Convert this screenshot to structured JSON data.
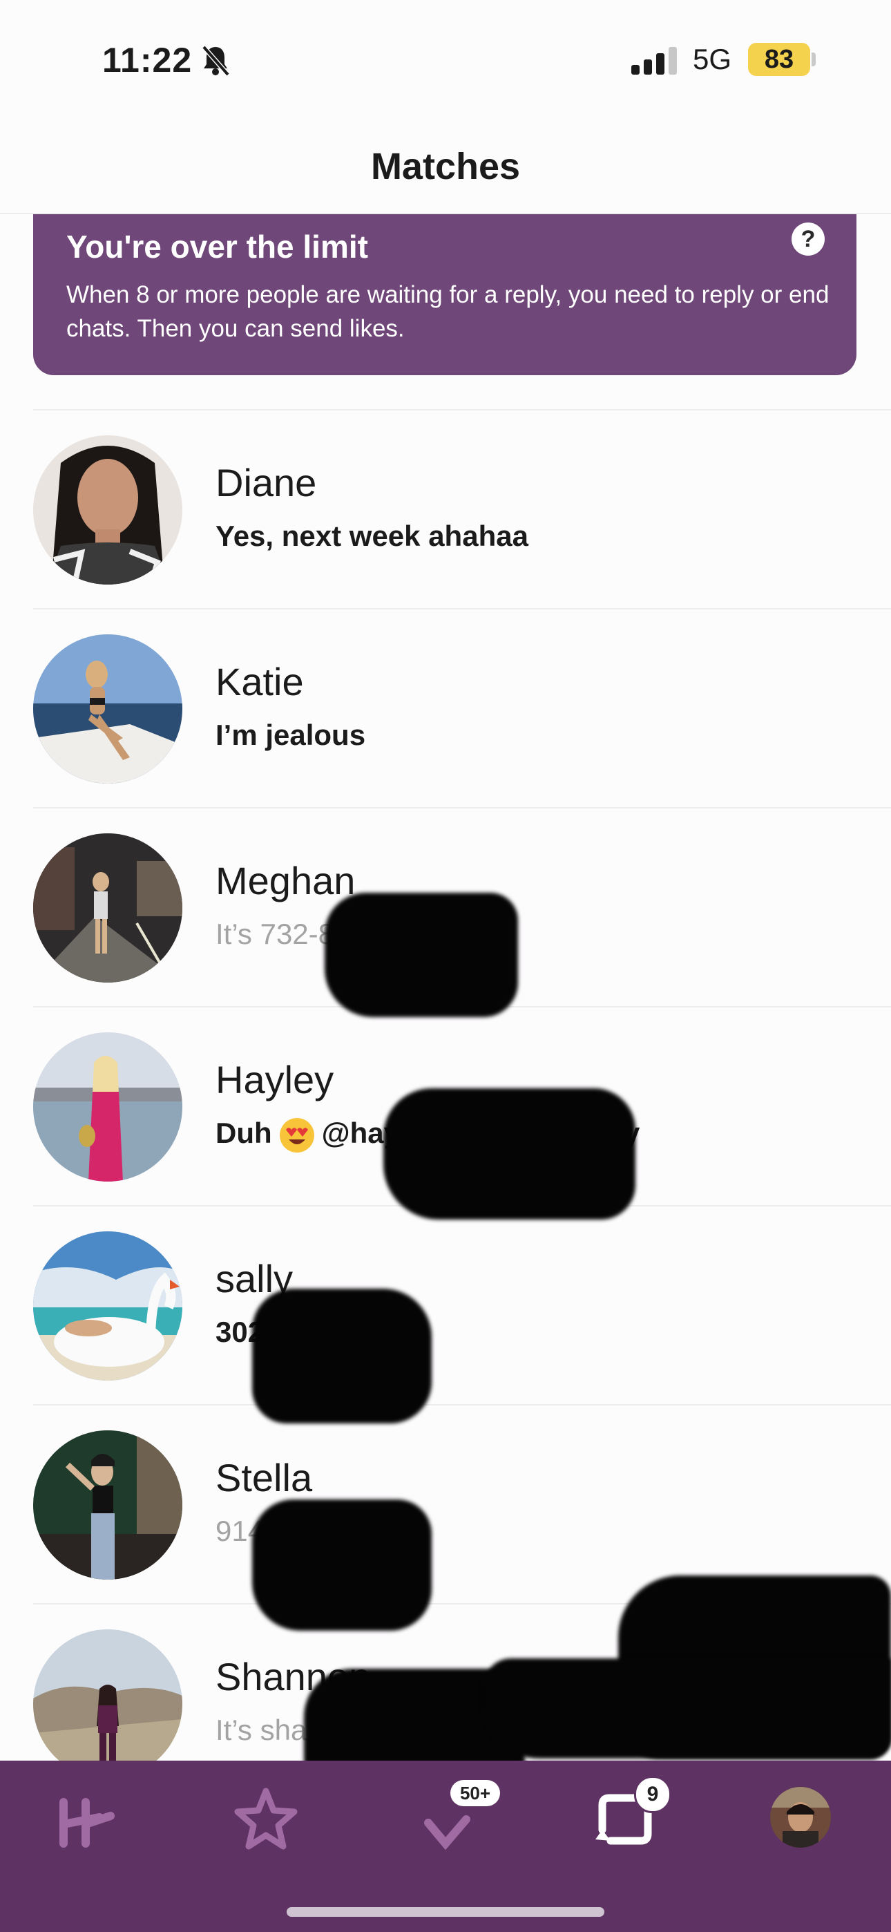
{
  "status_bar": {
    "time": "11:22",
    "network": "5G",
    "battery": "83"
  },
  "header": {
    "title": "Matches"
  },
  "banner": {
    "title": "You're over the limit",
    "help_label": "?",
    "text": "When 8 or more people are waiting for a reply, you need to reply or end chats. Then you can send likes."
  },
  "matches": [
    {
      "name": "Diane",
      "message": "Yes, next week ahahaa",
      "style": "bold"
    },
    {
      "name": "Katie",
      "message": "I’m jealous",
      "style": "bold"
    },
    {
      "name": "Meghan",
      "message": "It’s 732-8",
      "style": "light"
    },
    {
      "name": "Hayley",
      "message_pre": "Duh",
      "message_post": "@hay",
      "message_tail": "y",
      "style": "bold"
    },
    {
      "name": "sally",
      "message": "302",
      "style": "bold"
    },
    {
      "name": "Stella",
      "message": "914",
      "style": "light"
    },
    {
      "name": "Shannon",
      "message": "It’s sha                    umber is",
      "style": "light"
    }
  ],
  "tab_bar": {
    "tabs": [
      {
        "name": "home-icon"
      },
      {
        "name": "star-icon"
      },
      {
        "name": "likes-icon",
        "badge": "50+"
      },
      {
        "name": "chat-icon",
        "badge": "9"
      },
      {
        "name": "profile-avatar"
      }
    ]
  },
  "colors": {
    "brand_purple": "#6f4778",
    "tab_bar": "#5e3363",
    "battery": "#f4d24d"
  }
}
